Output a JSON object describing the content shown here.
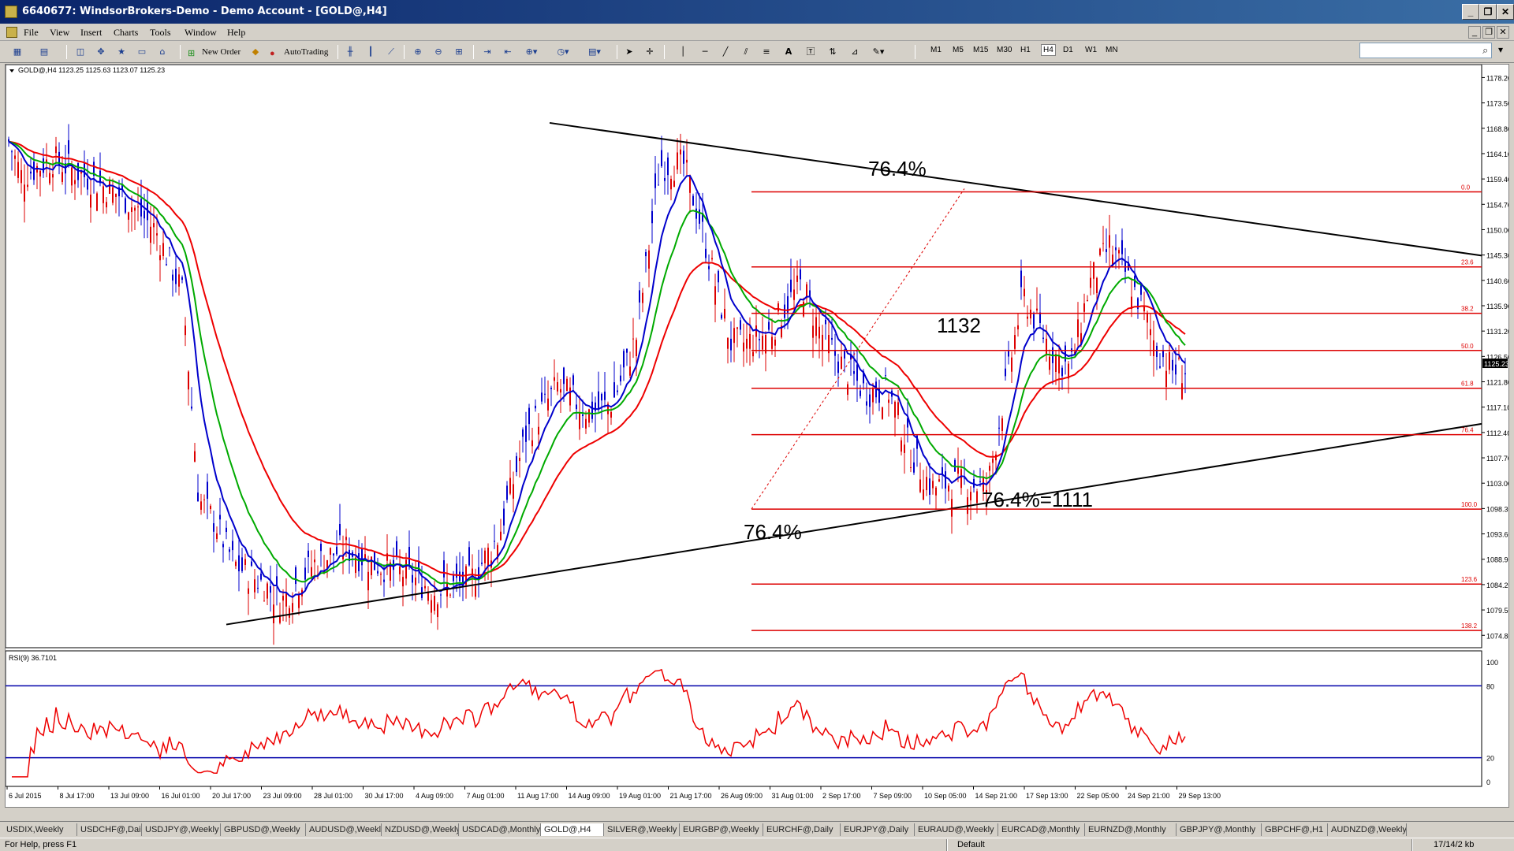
{
  "window": {
    "title": "6640677: WindsorBrokers-Demo - Demo Account - [GOLD@,H4]",
    "controls": {
      "minimize": "_",
      "restore": "❐",
      "close": "✕"
    }
  },
  "menu": [
    "File",
    "View",
    "Insert",
    "Charts",
    "Tools",
    "Window",
    "Help"
  ],
  "toolbar": {
    "new_order": "New Order",
    "auto_trading": "AutoTrading",
    "text_tool": "A",
    "timeframes": [
      "M1",
      "M5",
      "M15",
      "M30",
      "H1",
      "H4",
      "D1",
      "W1",
      "MN"
    ]
  },
  "chart": {
    "header": "GOLD@,H4  1123.25 1125.63 1123.07 1125.23",
    "current_price": "1125.23",
    "price_labels": [
      "1178.20",
      "1173.50",
      "1168.80",
      "1164.10",
      "1159.40",
      "1154.70",
      "1150.00",
      "1145.30",
      "1140.60",
      "1135.90",
      "1131.20",
      "1126.50",
      "1121.80",
      "1117.10",
      "1112.40",
      "1107.70",
      "1103.00",
      "1098.30",
      "1093.60",
      "1088.90",
      "1084.20",
      "1079.50",
      "1074.80"
    ],
    "time_labels": [
      "6 Jul 2015",
      "8 Jul 17:00",
      "13 Jul 09:00",
      "16 Jul 01:00",
      "20 Jul 17:00",
      "23 Jul 09:00",
      "28 Jul 01:00",
      "30 Jul 17:00",
      "4 Aug 09:00",
      "7 Aug 01:00",
      "11 Aug 17:00",
      "14 Aug 09:00",
      "19 Aug 01:00",
      "21 Aug 17:00",
      "26 Aug 09:00",
      "31 Aug 01:00",
      "2 Sep 17:00",
      "7 Sep 09:00",
      "10 Sep 05:00",
      "14 Sep 21:00",
      "17 Sep 13:00",
      "22 Sep 05:00",
      "24 Sep 21:00",
      "29 Sep 13:00"
    ],
    "fib_levels": [
      {
        "label": "0.0",
        "price": 1157.0
      },
      {
        "label": "23.6",
        "price": 1143.1
      },
      {
        "label": "38.2",
        "price": 1134.5
      },
      {
        "label": "50.0",
        "price": 1127.6
      },
      {
        "label": "61.8",
        "price": 1120.6
      },
      {
        "label": "76.4",
        "price": 1112.0
      },
      {
        "label": "100.0",
        "price": 1098.2
      },
      {
        "label": "123.6",
        "price": 1084.3
      },
      {
        "label": "138.2",
        "price": 1075.7
      }
    ],
    "annotations": {
      "top": "76.4%",
      "level_1132": "1132",
      "right": "76.4%=1111",
      "bottom": "76.4%"
    },
    "colors": {
      "bull": "#dd0000",
      "ema_fast": "#0000cc",
      "ema_mid": "#00aa00",
      "ema_slow": "#ee0000",
      "trendline": "#000000",
      "fib": "#dd0000",
      "rsi": "#ee0000",
      "rsi_levels": "#0000aa"
    }
  },
  "rsi": {
    "header": "RSI(9) 36.7101",
    "labels": [
      "100",
      "80",
      "20",
      "0"
    ],
    "upper_level": 80,
    "lower_level": 20
  },
  "tabs": [
    "USDIX,Weekly",
    "USDCHF@,Daily",
    "USDJPY@,Weekly",
    "GBPUSD@,Weekly",
    "AUDUSD@,Weekly",
    "NZDUSD@,Weekly",
    "USDCAD@,Monthly",
    "GOLD@,H4",
    "SILVER@,Weekly",
    "EURGBP@,Weekly",
    "EURCHF@,Daily",
    "EURJPY@,Daily",
    "EURAUD@,Weekly",
    "EURCAD@,Monthly",
    "EURNZD@,Monthly",
    "GBPJPY@,Monthly",
    "GBPCHF@,H1",
    "AUDNZD@,Weekly"
  ],
  "active_tab": "GOLD@,H4",
  "status": {
    "help": "For Help, press F1",
    "profile": "Default",
    "traffic": "17/14/2 kb"
  }
}
